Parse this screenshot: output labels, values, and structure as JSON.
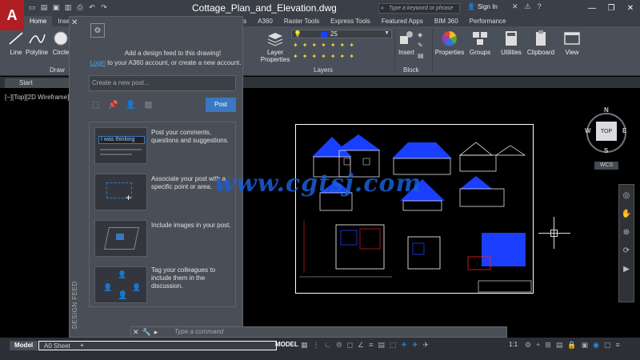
{
  "window": {
    "title": "Cottage_Plan_and_Elevation.dwg",
    "search_placeholder": "Type a keyword or phrase",
    "signin_label": "Sign In"
  },
  "ribbon": {
    "tabs": [
      "Home",
      "Insert",
      "dd-ins",
      "A360",
      "Raster Tools",
      "Express Tools",
      "Featured Apps",
      "BIM 360",
      "Performance"
    ],
    "draw_tools": [
      "Line",
      "Polyline",
      "Circle"
    ],
    "draw_panel_label": "Draw",
    "layer_properties_label": "Layer Properties",
    "layer_current": "25",
    "layers_panel_label": "Layers",
    "insert_label": "Insert",
    "block_panel_label": "Block",
    "properties_label": "Properties",
    "groups_label": "Groups",
    "utilities_label": "Utilities",
    "clipboard_label": "Clipboard",
    "view_label": "View"
  },
  "filetabs": {
    "start_label": "Start"
  },
  "viewport": {
    "label": "[−][Top][2D Wireframe]"
  },
  "design_feed": {
    "message_line1": "Add a design feed to this drawing!",
    "login_link": "Login",
    "message_line2_rest": " to your A360 account, or create a new account.",
    "new_post_placeholder": "Create a new post...",
    "post_button": "Post",
    "tip1_preview": "I was thinking",
    "tips": [
      "Post your comments, questions and suggestions.",
      "Associate your post with a specific point or area.",
      "Include images in your post.",
      "Tag your colleagues to include them in the discussion."
    ],
    "vertical_label": "DESIGN FEED"
  },
  "viewcube": {
    "face": "TOP",
    "north": "N",
    "south": "S",
    "east": "E",
    "west": "W",
    "wcs": "WCS"
  },
  "command_line": {
    "placeholder": "Type a command"
  },
  "status": {
    "layout_tabs": [
      "Model",
      "A0 Sheet"
    ],
    "add_tab": "+",
    "model_label": "MODEL",
    "scale": "1:1"
  },
  "watermark": {
    "text": "www.cgtsj.com"
  },
  "colors": {
    "app_red": "#b01e23",
    "accent_blue": "#3a78c2",
    "drawing_blue": "#1a3fff",
    "drawing_red": "#ff2020",
    "watermark_blue": "#1a5fd8"
  }
}
